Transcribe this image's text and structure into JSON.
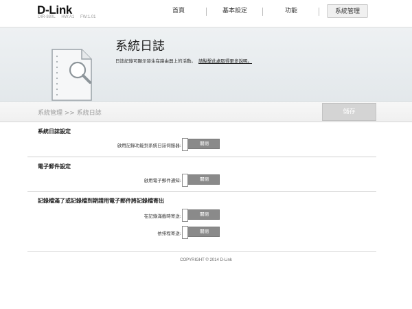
{
  "header": {
    "logo": "D-Link",
    "model": "DIR-880L",
    "hw": "HW:A1",
    "fw": "FW:1.01",
    "nav": [
      {
        "label": "首頁"
      },
      {
        "label": "基本設定"
      },
      {
        "label": "功能"
      },
      {
        "label": "系統管理"
      }
    ]
  },
  "banner": {
    "title": "系統日誌",
    "description": "日誌紀錄可顯示發生在路由器上的活動。",
    "link_text": "請點擊此處取得更多說明。"
  },
  "breadcrumb": "系統管理 >> 系統日誌",
  "save_label": "儲存",
  "sections": [
    {
      "title": "系統日誌設定",
      "rows": [
        {
          "label": "啟用記錄功能到系統日誌伺服器:",
          "toggle": "關閉"
        }
      ]
    },
    {
      "title": "電子郵件設定",
      "rows": [
        {
          "label": "啟用電子郵件通知:",
          "toggle": "關閉"
        }
      ]
    },
    {
      "title": "記錄檔滿了或記錄檔到期請用電子郵件將記錄檔寄出",
      "rows": [
        {
          "label": "在記錄滿載時寄送:",
          "toggle": "關閉"
        },
        {
          "label": "依排程寄送:",
          "toggle": "關閉"
        }
      ]
    }
  ],
  "footer": {
    "copyright": "COPYRIGHT © 2014 D-Link"
  },
  "colors": {
    "toggle_off": "#8a8a8a",
    "save_disabled": "#d4d4d4"
  },
  "icons": {
    "banner": "document-magnifier-icon"
  }
}
